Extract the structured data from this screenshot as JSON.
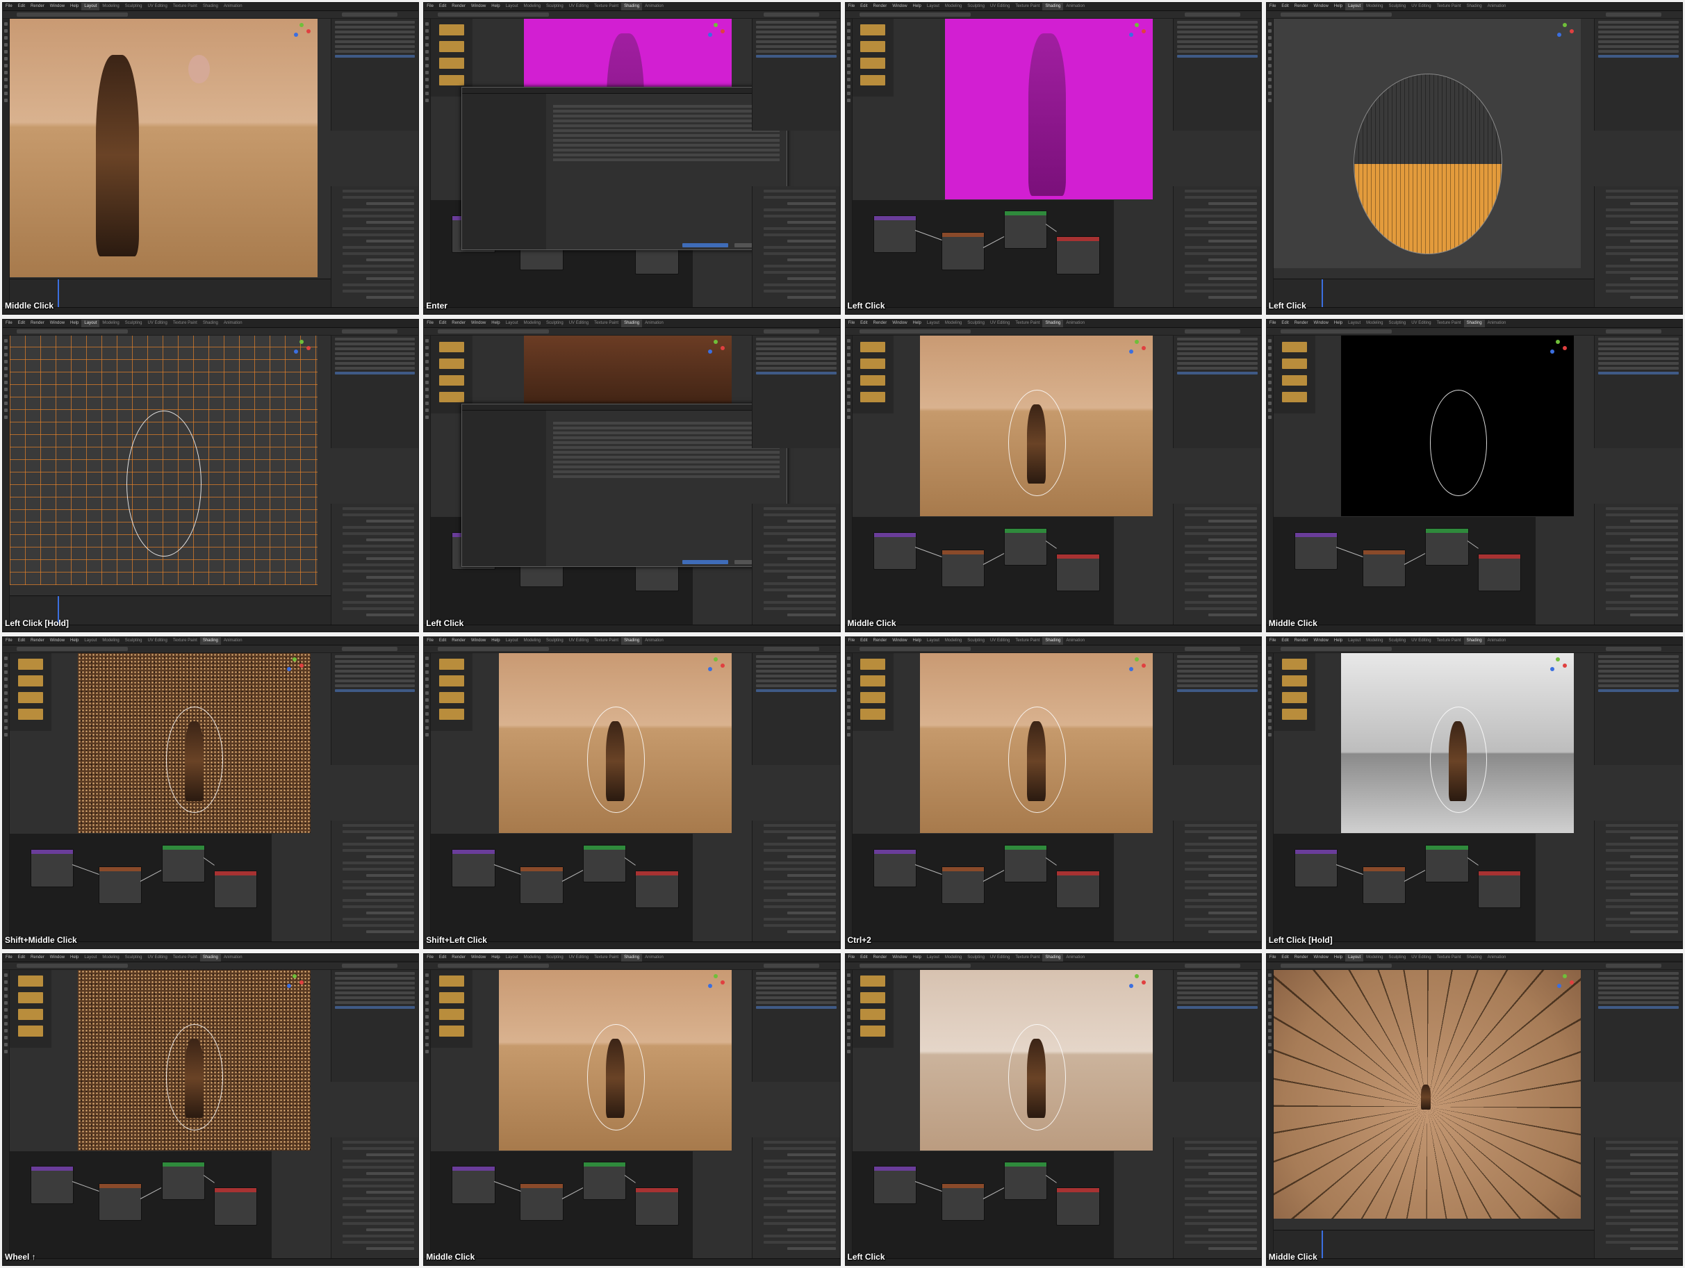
{
  "menu": {
    "items": [
      "File",
      "Edit",
      "Render",
      "Window",
      "Help"
    ],
    "workspaces": [
      "Layout",
      "Modeling",
      "Sculpting",
      "UV Editing",
      "Texture Paint",
      "Shading",
      "Animation"
    ]
  },
  "panels": [
    {
      "caption": "Middle Click",
      "scene": "desert-split",
      "active_workspace": "Layout",
      "colors": {
        "viewport": "#c99a73"
      }
    },
    {
      "caption": "Enter",
      "scene": "magenta-file-browser",
      "active_workspace": "Shading",
      "colors": {
        "viewport": "#d21fd2"
      }
    },
    {
      "caption": "Left Click",
      "scene": "magenta-nodes",
      "active_workspace": "Shading",
      "colors": {
        "viewport": "#d21fd2"
      }
    },
    {
      "caption": "Left Click",
      "scene": "sphere-half-orange",
      "active_workspace": "Layout",
      "colors": {
        "viewport": "#e39b3c"
      }
    },
    {
      "caption": "Left Click [Hold]",
      "scene": "orange-wireframe",
      "active_workspace": "Layout",
      "colors": {
        "viewport": "#e68228"
      }
    },
    {
      "caption": "Left Click",
      "scene": "file-browser",
      "active_workspace": "Shading",
      "colors": {
        "viewport": "#3a2012"
      }
    },
    {
      "caption": "Middle Click",
      "scene": "desert-figure",
      "active_workspace": "Shading",
      "colors": {
        "viewport": "#d9b28f"
      }
    },
    {
      "caption": "Middle Click",
      "scene": "black-render",
      "active_workspace": "Shading",
      "colors": {
        "viewport": "#000000"
      }
    },
    {
      "caption": "Shift+Middle Click",
      "scene": "noise-render",
      "active_workspace": "Shading",
      "colors": {
        "viewport": "#5a3a22"
      }
    },
    {
      "caption": "Shift+Left Click",
      "scene": "desert-figure",
      "active_workspace": "Shading",
      "colors": {
        "viewport": "#d9b28f"
      }
    },
    {
      "caption": "Ctrl+2",
      "scene": "desert-figure",
      "active_workspace": "Shading",
      "colors": {
        "viewport": "#d9b28f"
      }
    },
    {
      "caption": "Left Click [Hold]",
      "scene": "white-dome",
      "active_workspace": "Shading",
      "colors": {
        "viewport": "#e8e8e8"
      }
    },
    {
      "caption": "Wheel ↑",
      "scene": "noise-figure",
      "active_workspace": "Shading",
      "colors": {
        "viewport": "#5a3a22"
      }
    },
    {
      "caption": "Middle Click",
      "scene": "desert-figure",
      "active_workspace": "Shading",
      "colors": {
        "viewport": "#d9b28f"
      }
    },
    {
      "caption": "Left Click",
      "scene": "pale-figure",
      "active_workspace": "Shading",
      "colors": {
        "viewport": "#e5d6c9"
      }
    },
    {
      "caption": "Middle Click",
      "scene": "fisheye-sphere",
      "active_workspace": "Layout",
      "colors": {
        "viewport": "#c49873"
      }
    }
  ]
}
